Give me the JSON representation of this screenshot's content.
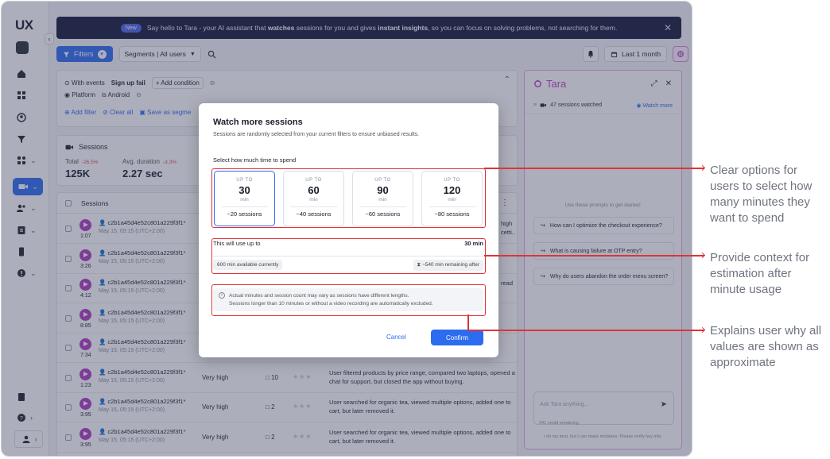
{
  "logo": "UX",
  "banner": {
    "badge": "New",
    "text_a": "Say hello to Tara - your AI assistant that ",
    "bold_a": "watches",
    "text_b": " sessions for you and gives ",
    "bold_b": "instant insights",
    "text_c": ", so you can focus on solving problems, not searching for them."
  },
  "toolbar": {
    "filters_label": "Filters",
    "segments_label": "Segments | All users",
    "date_label": "Last 1 month"
  },
  "filters": {
    "with_events": "With events",
    "event": "Sign up fail",
    "add_condition": "+ Add condition",
    "platform_label": "Platform",
    "platform_op": "is Android",
    "add_filter": "Add filter",
    "clear_all": "Clear all",
    "save_segment": "Save as segme"
  },
  "metrics": {
    "title": "Sessions",
    "total_label": "Total",
    "total_delta": "-26.5%",
    "total_value": "125K",
    "avg_label": "Avg. duration",
    "avg_delta": "-3.3%",
    "avg_value": "2.27 sec"
  },
  "table": {
    "header": "Sessions",
    "rows": [
      {
        "dur": "1:07",
        "id": "c2b1a45d4e52c801a229f3f1*",
        "date": "May 15, 05:15 (UTC+2:00)",
        "eng": "",
        "cnt": "",
        "summary": "high\ncetti.."
      },
      {
        "dur": "3:26",
        "id": "c2b1a45d4e52c801a229f3f1*",
        "date": "May 15, 05:15 (UTC+2:00)",
        "eng": "",
        "cnt": "",
        "summary": ""
      },
      {
        "dur": "4:12",
        "id": "c2b1a45d4e52c801a229f3f1*",
        "date": "May 15, 05:15 (UTC+2:00)",
        "eng": "",
        "cnt": "",
        "summary": "read"
      },
      {
        "dur": "8:85",
        "id": "c2b1a45d4e52c801a229f3f1*",
        "date": "May 15, 05:15 (UTC+2:00)",
        "eng": "",
        "cnt": "",
        "summary": ""
      },
      {
        "dur": "7:34",
        "id": "c2b1a45d4e52c801a229f3f1*",
        "date": "May 15, 05:15 (UTC+2:00)",
        "eng": "",
        "cnt": "",
        "summary": ""
      },
      {
        "dur": "1:23",
        "id": "c2b1a45d4e52c801a229f3f1*",
        "date": "May 15, 05:15 (UTC+2:00)",
        "eng": "Very high",
        "cnt": "10",
        "summary": "User filtered products by price range, compared two laptops, opened a chat for support, but closed the app without buying."
      },
      {
        "dur": "3:95",
        "id": "c2b1a45d4e52c801a229f3f1*",
        "date": "May 15, 05:15 (UTC+2:00)",
        "eng": "Very high",
        "cnt": "2",
        "summary": "User searched for organic tea, viewed multiple options, added one to cart, but later removed it."
      },
      {
        "dur": "3:95",
        "id": "c2b1a45d4e52c801a229f3f1*",
        "date": "May 15, 05:15 (UTC+2:00)",
        "eng": "Very high",
        "cnt": "2",
        "summary": "User searched for organic tea, viewed multiple options, added one to cart, but later removed it."
      }
    ]
  },
  "tara": {
    "title": "Tara",
    "watched": "47 sessions watched",
    "watch_more": "Watch more",
    "hint": "Use these prompts to get started:",
    "prompts": [
      "How can I optimize the checkout experience?",
      "What is causing failure at OTP entry?",
      "Why do users abandon the order menu screen?"
    ],
    "ask_placeholder": "Ask Tara anything...",
    "credit": "241 credit remaining",
    "disclaimer": "I do my best, but I can make mistakes. Please verify key info."
  },
  "modal": {
    "title": "Watch more sessions",
    "subtitle": "Sessions are randomly selected from your current filters to ensure unbiased results.",
    "question": "Select how much time to spend",
    "options": [
      {
        "upto": "UP TO",
        "num": "30",
        "unit": "min",
        "sessions": "~20 sessions"
      },
      {
        "upto": "UP TO",
        "num": "60",
        "unit": "min",
        "sessions": "~40 sessions"
      },
      {
        "upto": "UP TO",
        "num": "90",
        "unit": "min",
        "sessions": "~60 sessions"
      },
      {
        "upto": "UP TO",
        "num": "120",
        "unit": "min",
        "sessions": "~80 sessions"
      }
    ],
    "usage_label": "This will use up to",
    "usage_value": "30 min",
    "available": "600 min available currently",
    "remaining": "~540 min remaining after",
    "note_line1": "Actual minutes and session count may vary as sessions have different lengths.",
    "note_line2": "Sessions longer than 10 minutes or without a video recording are automatically excluded.",
    "cancel": "Cancel",
    "confirm": "Confirm"
  },
  "annotations": {
    "a1": "Clear options for users to select how many minutes they want to spend",
    "a2": "Provide context for estimation after minute usage",
    "a3": "Explains user why all values are shown as approximate"
  },
  "colors": {
    "accent": "#2b6cf0",
    "tara": "#c03ec8",
    "annotation": "#e0323a"
  }
}
